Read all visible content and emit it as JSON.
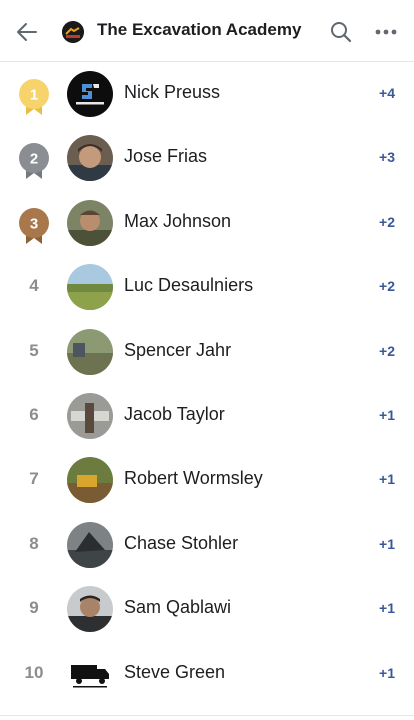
{
  "header": {
    "title": "The Excavation Academy",
    "icons": [
      "back-arrow-icon",
      "group-logo",
      "search-icon",
      "more-icon"
    ]
  },
  "leaderboard": [
    {
      "rank": "1",
      "badge": "gold",
      "badge_color": "#f7d46b",
      "name": "Nick Preuss",
      "points": "+4",
      "avatar": "grade-solutions-logo"
    },
    {
      "rank": "2",
      "badge": "silver",
      "badge_color": "#8a8d91",
      "name": "Jose Frias",
      "points": "+3",
      "avatar": "photo"
    },
    {
      "rank": "3",
      "badge": "bronze",
      "badge_color": "#a9774c",
      "name": "Max Johnson",
      "points": "+2",
      "avatar": "photo"
    },
    {
      "rank": "4",
      "name": "Luc Desaulniers",
      "points": "+2",
      "avatar": "photo"
    },
    {
      "rank": "5",
      "name": "Spencer Jahr",
      "points": "+2",
      "avatar": "photo"
    },
    {
      "rank": "6",
      "name": "Jacob Taylor",
      "points": "+1",
      "avatar": "photo"
    },
    {
      "rank": "7",
      "name": "Robert Wormsley",
      "points": "+1",
      "avatar": "photo"
    },
    {
      "rank": "8",
      "name": "Chase Stohler",
      "points": "+1",
      "avatar": "photo"
    },
    {
      "rank": "9",
      "name": "Sam Qablawi",
      "points": "+1",
      "avatar": "photo"
    },
    {
      "rank": "10",
      "name": "Steve Green",
      "points": "+1",
      "avatar": "truck-logo"
    }
  ],
  "colors": {
    "points": "#385898",
    "rank": "#8a8d91",
    "divider": "#e4e6eb"
  }
}
